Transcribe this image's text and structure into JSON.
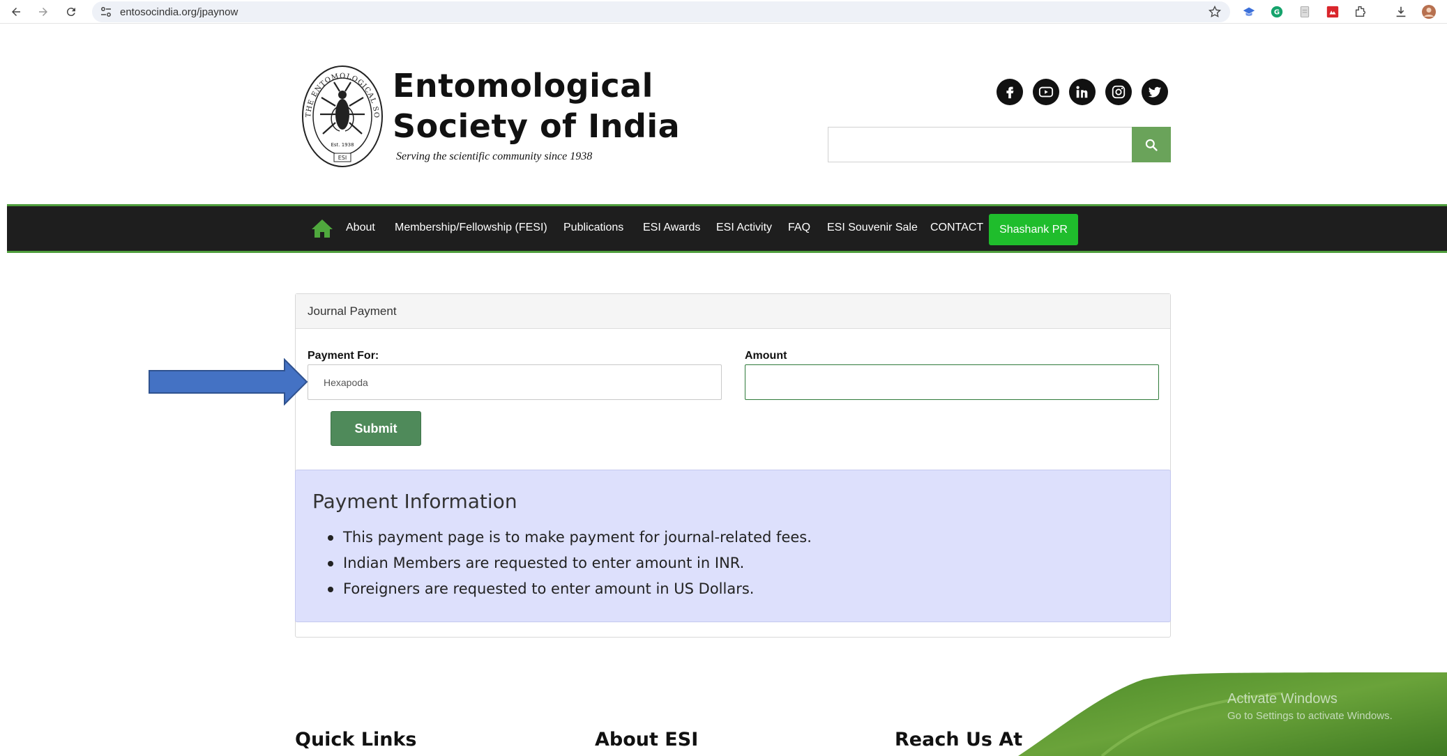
{
  "browser": {
    "url": "entosocindia.org/jpaynow"
  },
  "header": {
    "title_line1": "Entomological",
    "title_line2": "Society of India",
    "tagline": "Serving the scientific community since 1938",
    "seal_text": "THE ENTOMOLOGICAL SOCIETY OF INDIA",
    "seal_est": "Est. 1938",
    "seal_abbr": "ESI",
    "social": [
      "facebook-icon",
      "youtube-icon",
      "linkedin-icon",
      "instagram-icon",
      "twitter-icon"
    ],
    "search_placeholder": ""
  },
  "nav": {
    "items": [
      "About",
      "Membership/Fellowship (FESI)",
      "Publications",
      "ESI Awards",
      "ESI Activity",
      "FAQ",
      "ESI Souvenir Sale",
      "CONTACT"
    ],
    "user_button": "Shashank PR"
  },
  "card": {
    "title": "Journal Payment",
    "payment_for_label": "Payment For:",
    "payment_for_value": "Hexapoda",
    "amount_label": "Amount",
    "amount_value": "",
    "submit_label": "Submit"
  },
  "info": {
    "title": "Payment Information",
    "items": [
      "This payment page is to make payment for journal-related fees.",
      "Indian Members are requested to enter amount in INR.",
      "Foreigners are requested to enter amount in US Dollars."
    ]
  },
  "footer": {
    "quick_links": "Quick Links",
    "about": "About ESI",
    "reach": "Reach Us At"
  },
  "overlay": {
    "watermark_line1": "Activate Windows",
    "watermark_line2": "Go to Settings to activate Windows."
  },
  "colors": {
    "nav_bg": "#1e1e1e",
    "nav_border": "#4e9d3c",
    "cta_green": "#1fbd2c",
    "submit_green": "#4f8a5a",
    "info_bg": "#dde0fc",
    "arrow_blue": "#4472c4"
  }
}
